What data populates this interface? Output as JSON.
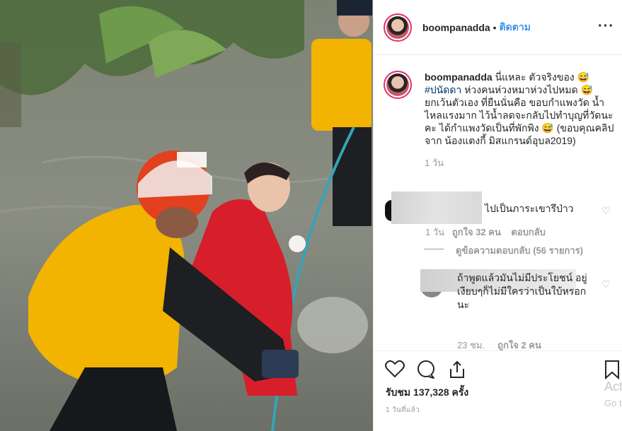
{
  "header": {
    "username": "boompanadda",
    "separator": "•",
    "follow_label": "ติดตาม",
    "more_label": "···"
  },
  "caption": {
    "username": "boompanadda",
    "text_1": "นี่แหละ ตัวจริงของ 😅",
    "hashtag": "#ปนัดดา",
    "text_2": "ห่วงคนห่วงหมาห่วงไปหมด 😅 ยกเว้นตัวเอง ที่ยืนนั่นคือ ขอบกำแพงวัด น้ำไหลแรงมาก ไว้น้ำลดจะกลับไปทำบุญที่วัดนะคะ ได้กำแพงวัดเป็นที่พักพิง 😅 (ขอบคุณคลิปจาก น้องแตงกี้ มิสแกรนด์อุบล2019)",
    "time": "1 วัน"
  },
  "comment_1": {
    "text": "ไปเป็นภาระเขารึป่าว",
    "time": "1 วัน",
    "likes": "ถูกใจ 32 คน",
    "reply": "ตอบกลับ",
    "view_replies": "ดูข้อความตอบกลับ (56 รายการ)"
  },
  "comment_2": {
    "text": "ถ้าพูดแล้วมันไม่มีประโยชน์ อยู่เงียบๆก็ไม่มีใครว่าเป็นใบ้หรอกนะ",
    "time": "23 ชม.",
    "likes": "ถูกใจ 2 คน"
  },
  "actions": {
    "likes_text": "รับชม 137,328 ครั้ง",
    "posted_ago": "1 วันที่แล้ว",
    "side_label": "Act",
    "side_sub": "Go t"
  },
  "colors": {
    "accent": "#3897f0",
    "hashtag": "#003569",
    "muted": "#999999",
    "vest": "#f2b400",
    "suit": "#d61f2a"
  }
}
